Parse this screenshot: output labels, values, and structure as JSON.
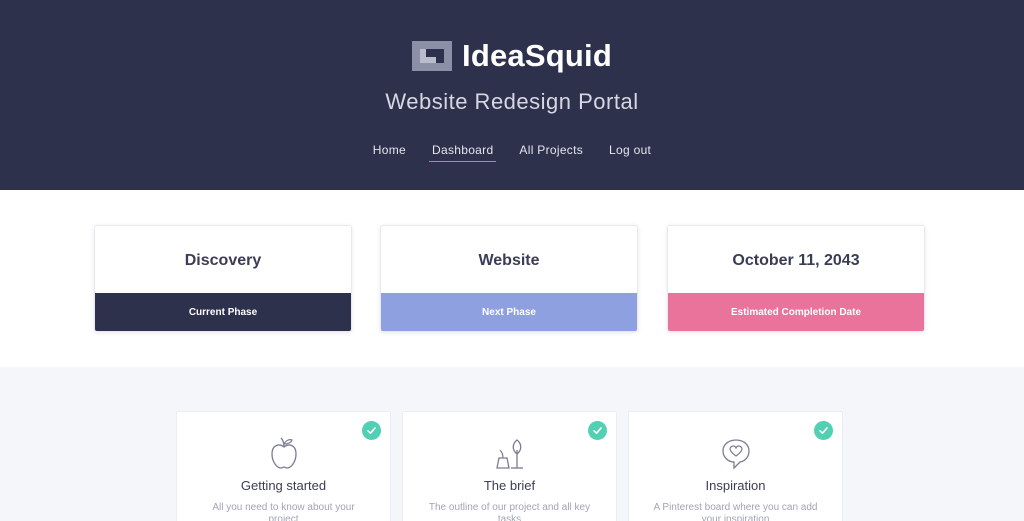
{
  "header": {
    "logo_text": "IdeaSquid",
    "portal_title": "Website Redesign Portal",
    "nav": [
      {
        "label": "Home",
        "active": false
      },
      {
        "label": "Dashboard",
        "active": true
      },
      {
        "label": "All Projects",
        "active": false
      },
      {
        "label": "Log out",
        "active": false
      }
    ]
  },
  "phases": [
    {
      "value": "Discovery",
      "label": "Current Phase",
      "color": "#2e314b"
    },
    {
      "value": "Website",
      "label": "Next Phase",
      "color": "#8ea0e0"
    },
    {
      "value": "October 11, 2043",
      "label": "Estimated Completion Date",
      "color": "#e9739a"
    }
  ],
  "tasks": [
    {
      "title": "Getting started",
      "description": "All you need to know about your project",
      "icon": "apple-icon",
      "completed": true
    },
    {
      "title": "The brief",
      "description": "The outline of our project and all key tasks",
      "icon": "plant-icon",
      "completed": true
    },
    {
      "title": "Inspiration",
      "description": "A Pinterest board where you can add your inspiration",
      "icon": "heart-bubble-icon",
      "completed": true
    }
  ],
  "colors": {
    "header_bg": "#2e314b",
    "accent_pink": "#e36f8f",
    "check_green": "#52d0b4",
    "section_bg": "#f5f6fa"
  }
}
